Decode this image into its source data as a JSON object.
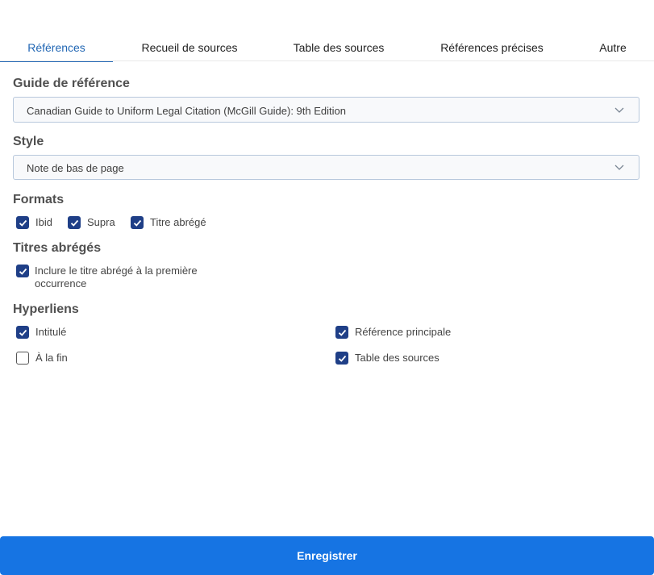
{
  "tabs": [
    {
      "label": "Références",
      "active": true
    },
    {
      "label": "Recueil de sources",
      "active": false
    },
    {
      "label": "Table des sources",
      "active": false
    },
    {
      "label": "Références précises",
      "active": false
    },
    {
      "label": "Autre",
      "active": false
    }
  ],
  "guide": {
    "title": "Guide de référence",
    "value": "Canadian Guide to Uniform Legal Citation (McGill Guide): 9th Edition",
    "icon": "chevron-down-icon"
  },
  "style": {
    "title": "Style",
    "value": "Note de bas de page",
    "icon": "chevron-down-icon"
  },
  "formats": {
    "title": "Formats",
    "items": [
      {
        "label": "Ibid",
        "checked": true
      },
      {
        "label": "Supra",
        "checked": true
      },
      {
        "label": "Titre abrégé",
        "checked": true
      }
    ]
  },
  "short_titles": {
    "title": "Titres abrégés",
    "items": [
      {
        "label_line1": "Inclure le titre abrégé à la première",
        "label_line2": "occurrence",
        "checked": true
      }
    ]
  },
  "hyperlinks": {
    "title": "Hyperliens",
    "items": [
      {
        "label": "Intitulé",
        "checked": true
      },
      {
        "label": "Référence principale",
        "checked": true
      },
      {
        "label": "À la fin",
        "checked": false
      },
      {
        "label": "Table des sources",
        "checked": true
      }
    ]
  },
  "save_label": "Enregistrer",
  "colors": {
    "accent": "#2267b4",
    "checkbox": "#1f3f87",
    "button": "#1674e3"
  }
}
